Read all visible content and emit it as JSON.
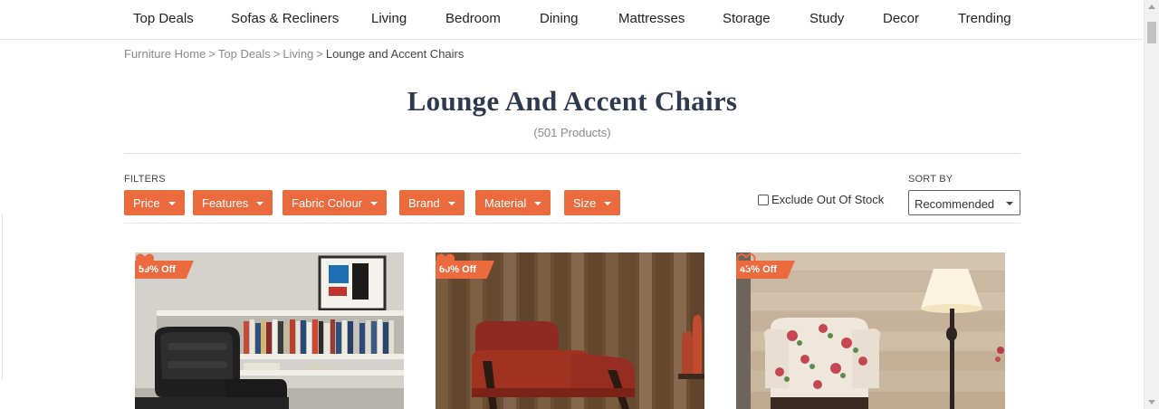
{
  "nav": {
    "items": [
      "Top Deals",
      "Sofas & Recliners",
      "Living",
      "Bedroom",
      "Dining",
      "Mattresses",
      "Storage",
      "Study",
      "Decor",
      "Trending"
    ]
  },
  "breadcrumb": {
    "items": [
      "Furniture Home",
      "Top Deals",
      "Living"
    ],
    "separator": ">",
    "current": "Lounge and Accent Chairs"
  },
  "page": {
    "title": "Lounge And Accent Chairs",
    "count": "(501 Products)"
  },
  "filters": {
    "label": "FILTERS",
    "buttons": [
      "Price",
      "Features",
      "Fabric Colour",
      "Brand",
      "Material",
      "Size"
    ],
    "exclude_label": "Exclude Out Of Stock"
  },
  "sort": {
    "label": "SORT BY",
    "selected": "Recommended"
  },
  "products": [
    {
      "discount": "59% Off",
      "wishlist_filled": true,
      "icon": "heart-icon"
    },
    {
      "discount": "60% Off",
      "wishlist_filled": true,
      "icon": "heart-icon"
    },
    {
      "discount": "45% Off",
      "wishlist_filled": false,
      "icon": "heart-icon"
    }
  ],
  "colors": {
    "accent": "#eb6b3f",
    "title": "#2d3a4f"
  }
}
